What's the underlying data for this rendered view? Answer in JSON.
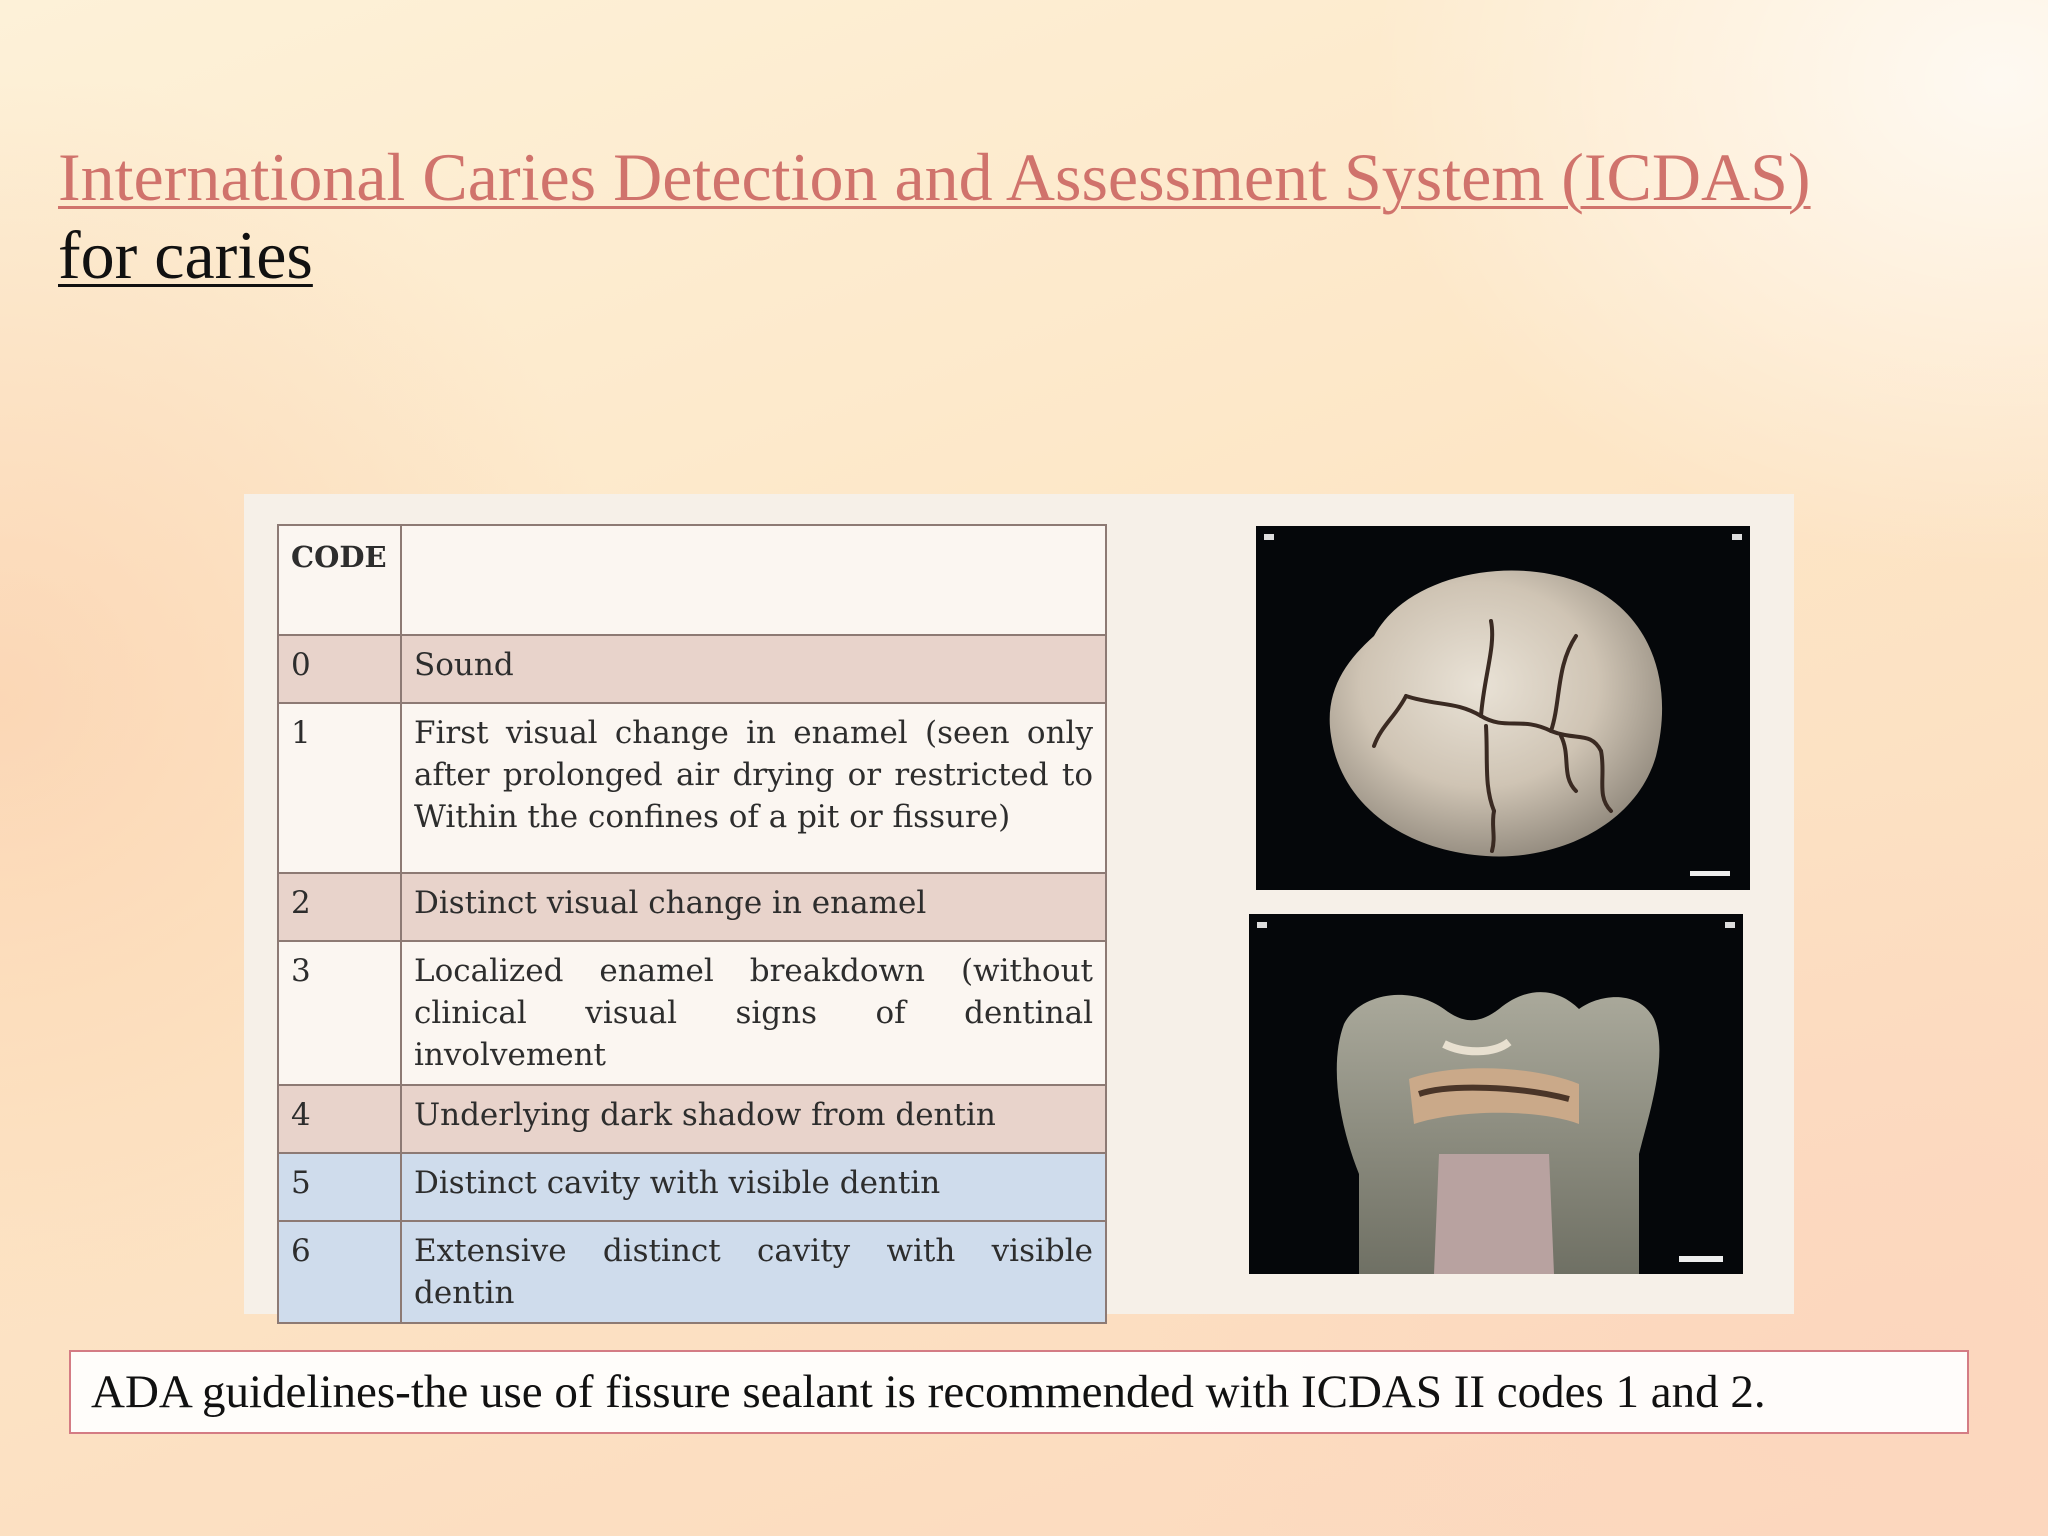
{
  "slide": {
    "title": "International Caries Detection and Assessment System (ICDAS)",
    "subtitle": "for caries"
  },
  "table": {
    "header": {
      "code": "CODE",
      "description": ""
    },
    "rows": [
      {
        "code": "0",
        "description": "Sound",
        "shade": "pink"
      },
      {
        "code": "1",
        "description": "First visual change in enamel (seen only after prolonged air drying or restricted to Within the confines of a pit or fissure)",
        "shade": "white"
      },
      {
        "code": "2",
        "description": "Distinct visual change in enamel",
        "shade": "pink"
      },
      {
        "code": "3",
        "description": "Localized enamel breakdown (without clinical visual signs of dentinal involvement",
        "shade": "white"
      },
      {
        "code": "4",
        "description": "Underlying dark shadow from dentin",
        "shade": "pink"
      },
      {
        "code": "5",
        "description": "Distinct cavity with visible dentin",
        "shade": "blue"
      },
      {
        "code": "6",
        "description": "Extensive distinct cavity with visible dentin",
        "shade": "blue"
      }
    ]
  },
  "colors": {
    "title": "#d0736c",
    "row_pink": "#e8d3cb",
    "row_white": "#fbf6f1",
    "row_blue": "#cfdcec",
    "note_border": "#d47c84"
  },
  "note": {
    "text": "ADA guidelines-the use of fissure sealant is recommended with ICDAS II codes 1 and 2."
  }
}
